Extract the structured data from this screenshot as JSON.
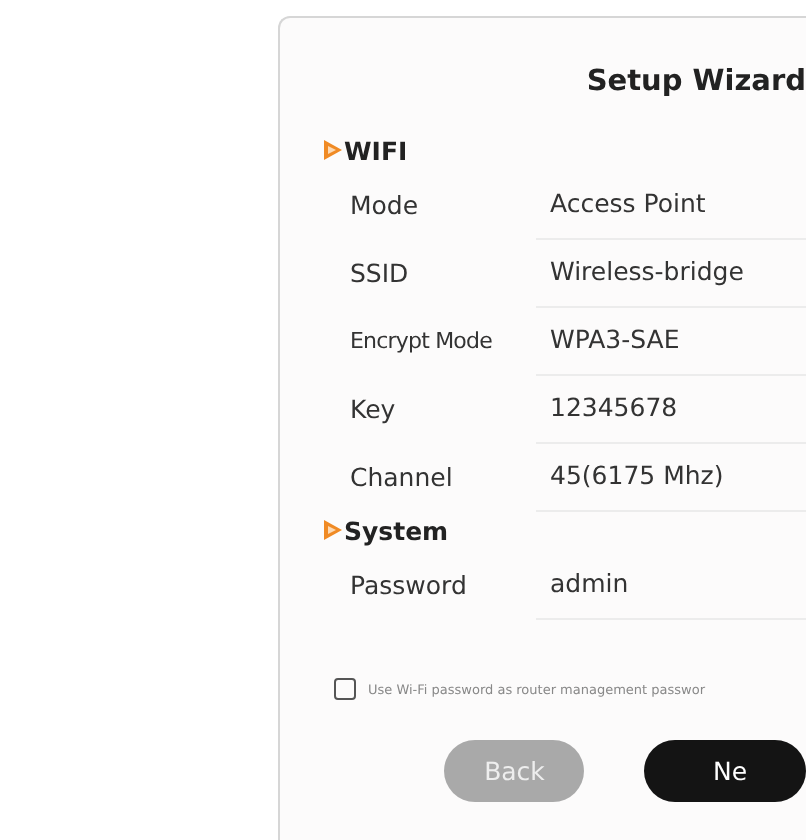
{
  "dialog": {
    "title": "Setup Wizard",
    "sections": [
      {
        "title": "WIFI",
        "fields": [
          {
            "label": "Mode",
            "value": "Access Point"
          },
          {
            "label": "SSID",
            "value": "Wireless-bridge"
          },
          {
            "label": "Encrypt Mode",
            "value": "WPA3-SAE"
          },
          {
            "label": "Key",
            "value": "12345678"
          },
          {
            "label": "Channel",
            "value": "45(6175 Mhz)"
          }
        ]
      },
      {
        "title": "System",
        "fields": [
          {
            "label": "Password",
            "value": "admin"
          }
        ]
      }
    ],
    "checkbox": {
      "label": "Use Wi-Fi password as router management passwor",
      "checked": false
    },
    "buttons": [
      {
        "label": "Back",
        "kind": "secondary"
      },
      {
        "label": "Ne",
        "kind": "primary"
      }
    ]
  }
}
